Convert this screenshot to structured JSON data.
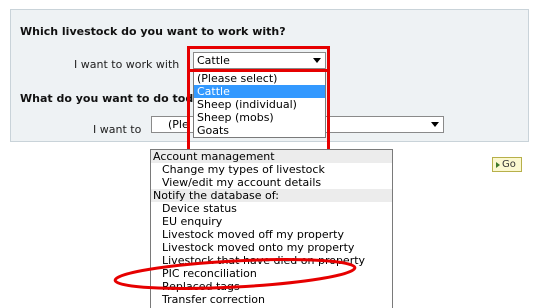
{
  "livestock_section": {
    "heading": "Which livestock do you want to work with?",
    "label": "I want to work with",
    "selected": "Cattle",
    "options": [
      "(Please select)",
      "Cattle",
      "Sheep (individual)",
      "Sheep (mobs)",
      "Goats"
    ],
    "selected_index": 1
  },
  "action_section": {
    "heading": "What do you want to do tod",
    "label": "I want to",
    "selected": "(Ple",
    "groups": [
      {
        "label": "Account management",
        "items": [
          "Change my types of livestock",
          "View/edit my account details"
        ]
      },
      {
        "label": "Notify the database of:",
        "items": [
          "Device status",
          "EU enquiry",
          "Livestock moved off my property",
          "Livestock moved onto my property",
          "Livestock that have died on property",
          "PIC reconciliation",
          "Replaced tags",
          "Transfer correction"
        ]
      }
    ]
  },
  "go_button": {
    "label": "Go",
    "icon": "play-arrow-icon"
  },
  "colors": {
    "highlight": "#e60000",
    "selection": "#3399ff",
    "panel": "#eef2f4"
  }
}
